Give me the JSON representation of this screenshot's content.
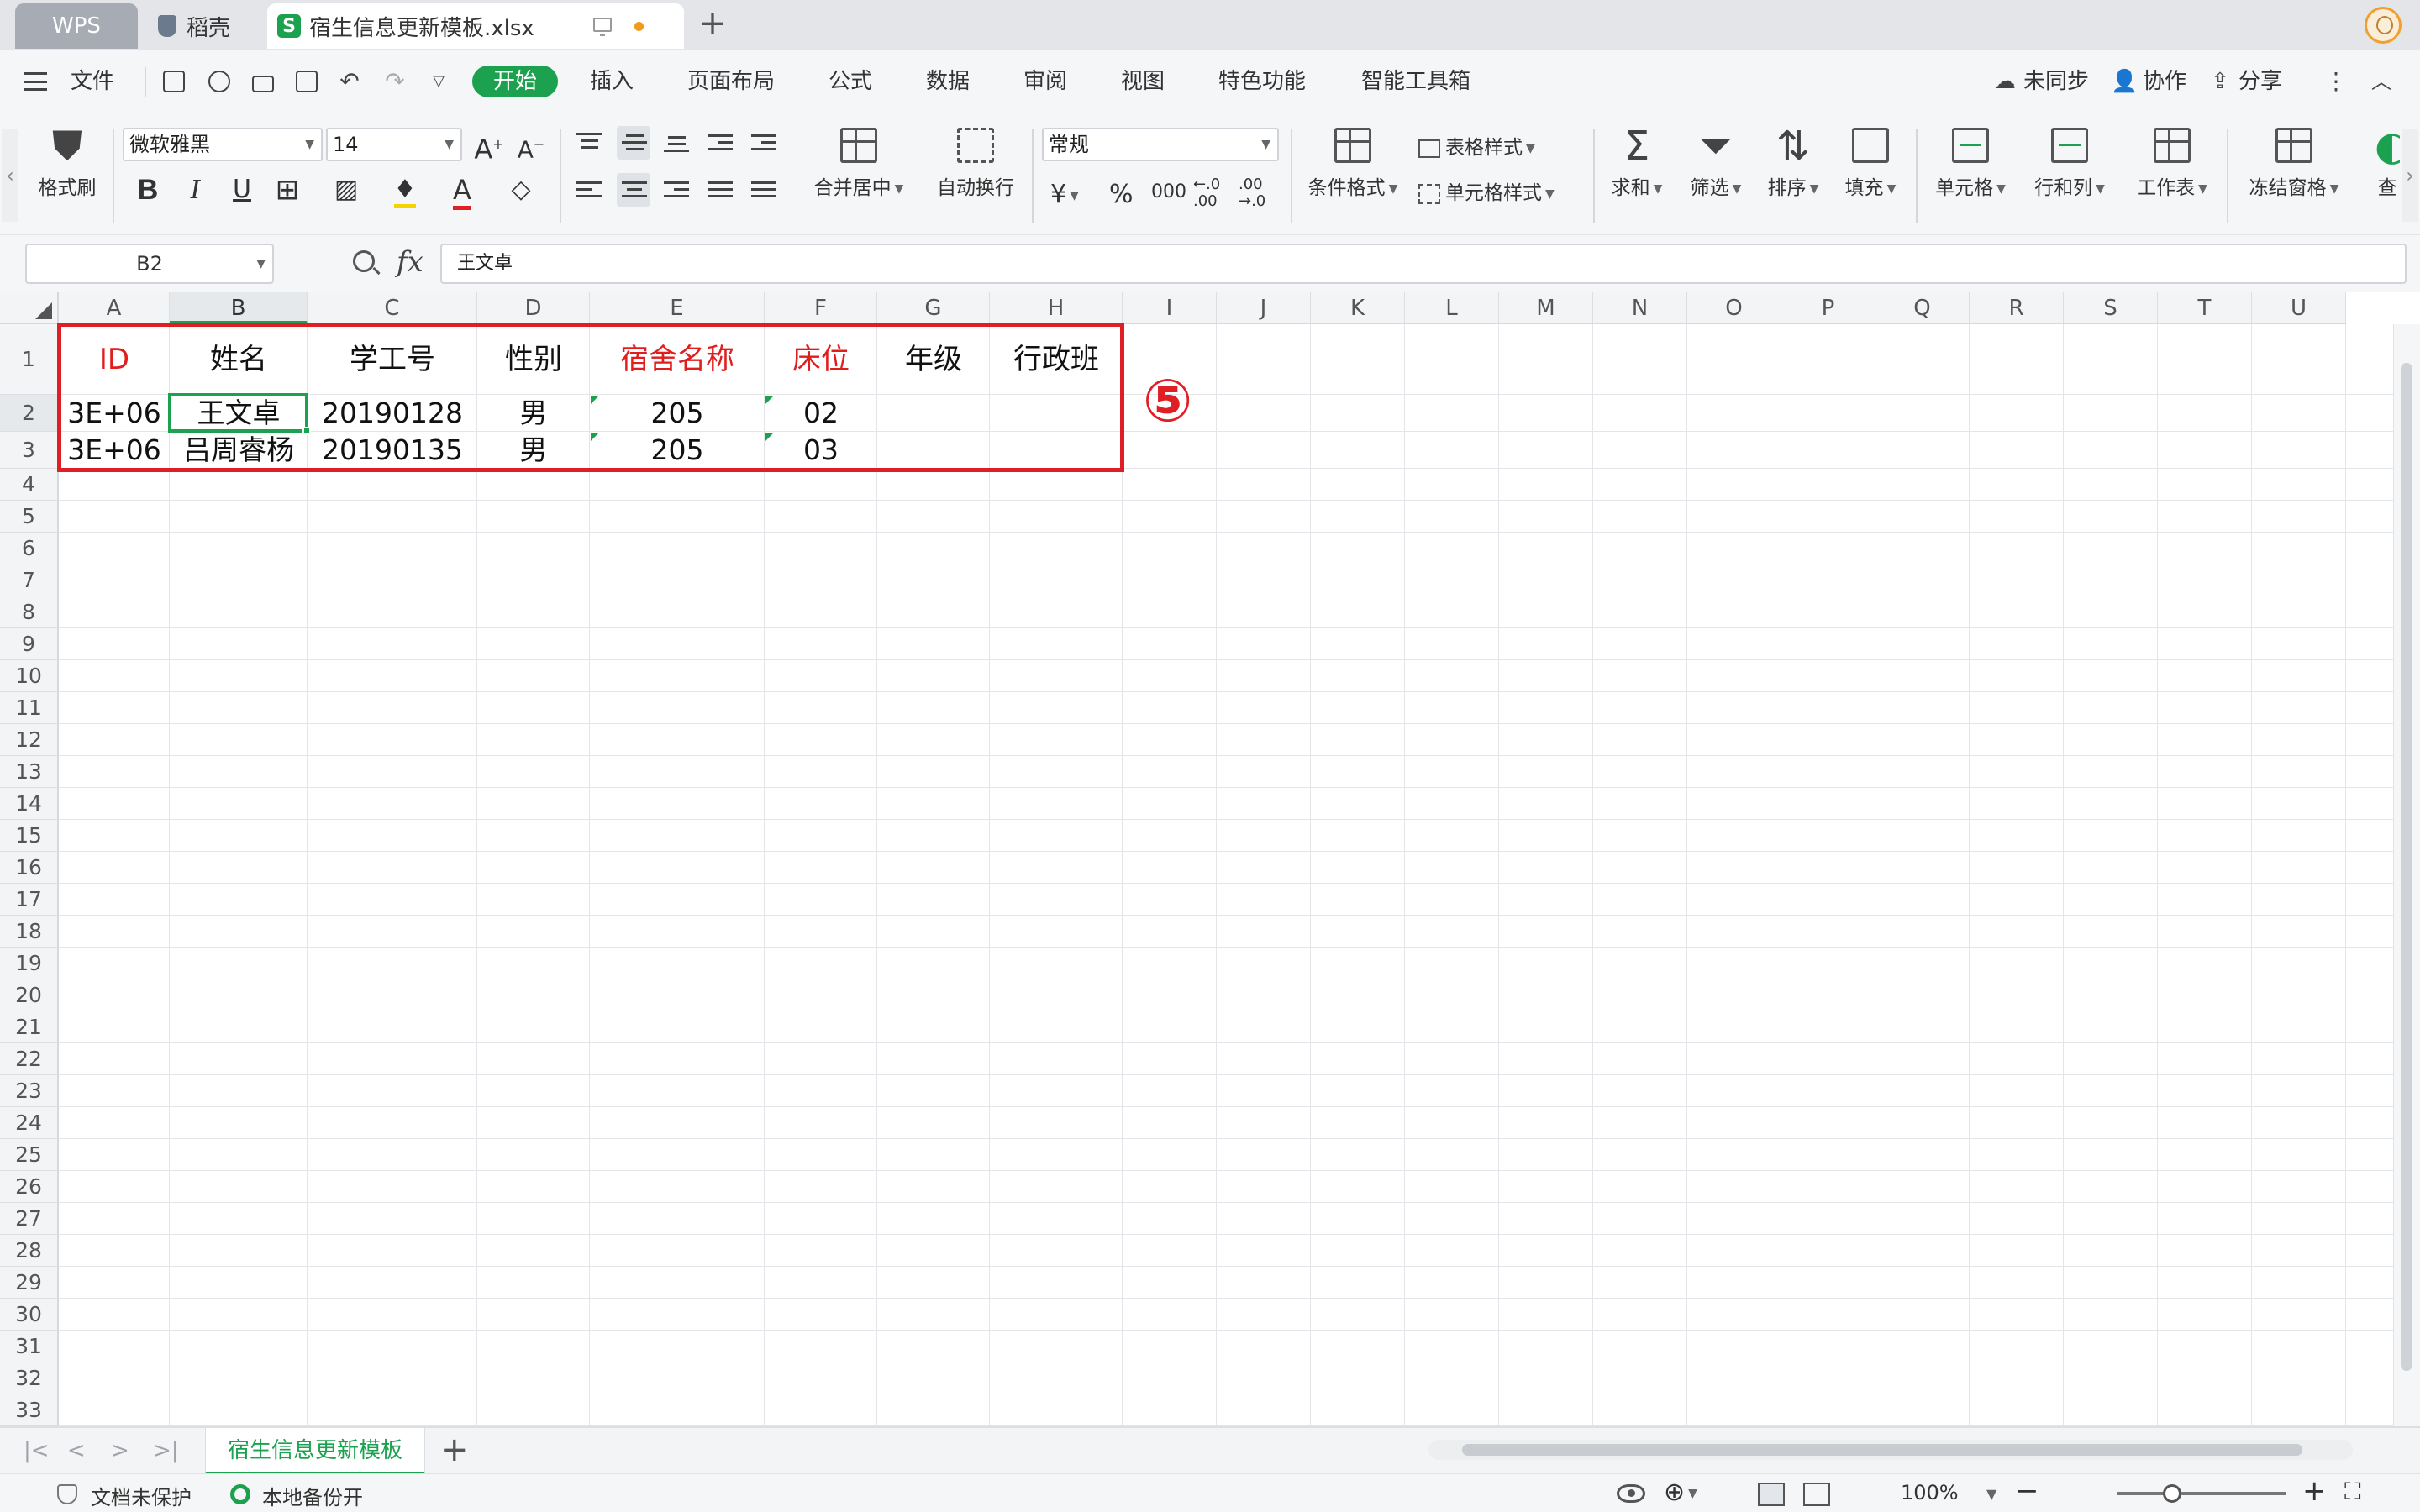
{
  "tabs": {
    "wps": "WPS",
    "daoke": "稻壳",
    "file": "宿生信息更新模板.xlsx",
    "add": "+"
  },
  "menu": {
    "file": "文件",
    "items": [
      "开始",
      "插入",
      "页面布局",
      "公式",
      "数据",
      "审阅",
      "视图",
      "特色功能",
      "智能工具箱"
    ],
    "sync": "未同步",
    "collab": "协作",
    "share": "分享"
  },
  "ribbon": {
    "format_painter": "格式刷",
    "font_name": "微软雅黑",
    "font_size": "14",
    "merge_center": "合并居中",
    "wrap_text": "自动换行",
    "number_format": "常规",
    "currency": "¥",
    "percent": "%",
    "thousands": "000",
    "dec_inc": "←.0\n.00",
    "dec_dec": ".00\n→.0",
    "conditional_format": "条件格式",
    "table_style": "表格样式",
    "cell_style": "单元格样式",
    "sum": "求和",
    "filter": "筛选",
    "sort": "排序",
    "fill": "填充",
    "cell": "单元格",
    "row_col": "行和列",
    "worksheet": "工作表",
    "freeze": "冻结窗格",
    "more": "查"
  },
  "formula_bar": {
    "name_box": "B2",
    "fx": "fx",
    "content": "王文卓"
  },
  "columns": [
    "A",
    "B",
    "C",
    "D",
    "E",
    "F",
    "G",
    "H",
    "I",
    "J",
    "K",
    "L",
    "M",
    "N",
    "O",
    "P",
    "Q",
    "R",
    "S",
    "T",
    "U"
  ],
  "rows": [
    "1",
    "2",
    "3",
    "4",
    "5",
    "6",
    "7",
    "8",
    "9",
    "10",
    "11",
    "12",
    "13",
    "14",
    "15",
    "16",
    "17",
    "18",
    "19",
    "20",
    "21",
    "22",
    "23",
    "24",
    "25",
    "26",
    "27",
    "28",
    "29",
    "30",
    "31",
    "32",
    "33"
  ],
  "table": {
    "headers": [
      "ID",
      "姓名",
      "学工号",
      "性别",
      "宿舍名称",
      "床位",
      "年级",
      "行政班"
    ],
    "red_headers": [
      0,
      4,
      5
    ],
    "rows": [
      [
        "3E+06",
        "王文卓",
        "20190128",
        "男",
        "205",
        "02",
        "",
        ""
      ],
      [
        "3E+06",
        "吕周睿杨",
        "20190135",
        "男",
        "205",
        "03",
        "",
        ""
      ]
    ]
  },
  "annotation": "⑤",
  "accent_color": "#1ca14f",
  "annotation_color": "#e01e25",
  "sheet_tab": "宿生信息更新模板",
  "status": {
    "protect": "文档未保护",
    "backup": "本地备份开",
    "zoom": "100%"
  }
}
